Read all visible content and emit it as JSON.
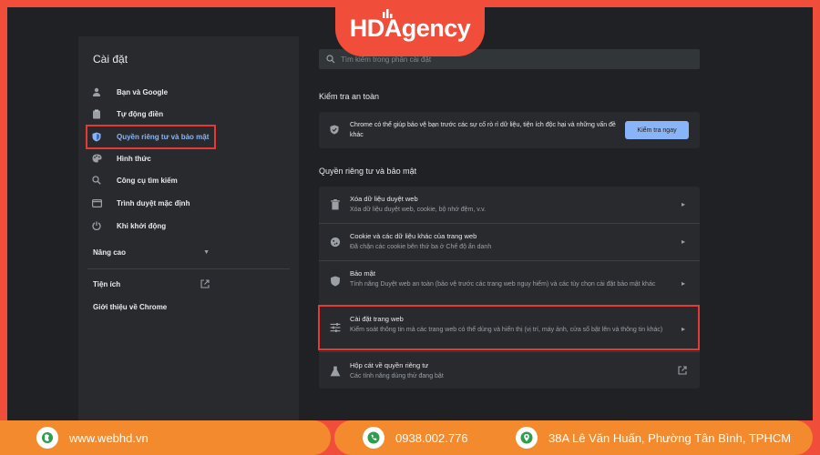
{
  "brand": {
    "name": "HDAgency"
  },
  "header": {
    "title": "Cài đặt",
    "search_placeholder": "Tìm kiếm trong phần cài đặt"
  },
  "sidebar": {
    "items": [
      {
        "label": "Bạn và Google",
        "icon": "person-icon"
      },
      {
        "label": "Tự động điền",
        "icon": "clipboard-icon"
      },
      {
        "label": "Quyền riêng tư và bảo mật",
        "icon": "shield-icon",
        "active": true
      },
      {
        "label": "Hình thức",
        "icon": "palette-icon"
      },
      {
        "label": "Công cụ tìm kiếm",
        "icon": "search-icon"
      },
      {
        "label": "Trình duyệt mặc định",
        "icon": "browser-icon"
      },
      {
        "label": "Khi khởi động",
        "icon": "power-icon"
      }
    ],
    "advanced": "Nâng cao",
    "extensions": "Tiện ích",
    "about": "Giới thiệu về Chrome"
  },
  "safety": {
    "title": "Kiểm tra an toàn",
    "text": "Chrome có thể giúp bảo vệ bạn trước các sự cố rò rỉ dữ liệu, tiện ích độc hại và những vấn đề khác",
    "button": "Kiểm tra ngay"
  },
  "privacy": {
    "title": "Quyền riêng tư và bảo mật",
    "rows": [
      {
        "title": "Xóa dữ liệu duyệt web",
        "subtitle": "Xóa dữ liệu duyệt web, cookie, bộ nhớ đệm, v.v.",
        "icon": "trash-icon"
      },
      {
        "title": "Cookie và các dữ liệu khác của trang web",
        "subtitle": "Đã chặn các cookie bên thứ ba ở Chế độ ẩn danh",
        "icon": "cookie-icon"
      },
      {
        "title": "Bảo mật",
        "subtitle": "Tính năng Duyệt web an toàn (bảo vệ trước các trang web nguy hiểm) và các tùy chọn cài đặt bảo mật khác",
        "icon": "shield-icon"
      },
      {
        "title": "Cài đặt trang web",
        "subtitle": "Kiểm soát thông tin mà các trang web có thể dùng và hiển thị (vị trí, máy ảnh, cửa sổ bật lên và thông tin khác)",
        "icon": "sliders-icon"
      },
      {
        "title": "Hộp cát về quyền riêng tư",
        "subtitle": "Các tính năng dùng thử đang bật",
        "icon": "flask-icon"
      }
    ]
  },
  "footer": {
    "website": "www.webhd.vn",
    "phone": "0938.002.776",
    "address": "38A Lê Văn Huấn, Phường Tân Bình, TPHCM"
  }
}
